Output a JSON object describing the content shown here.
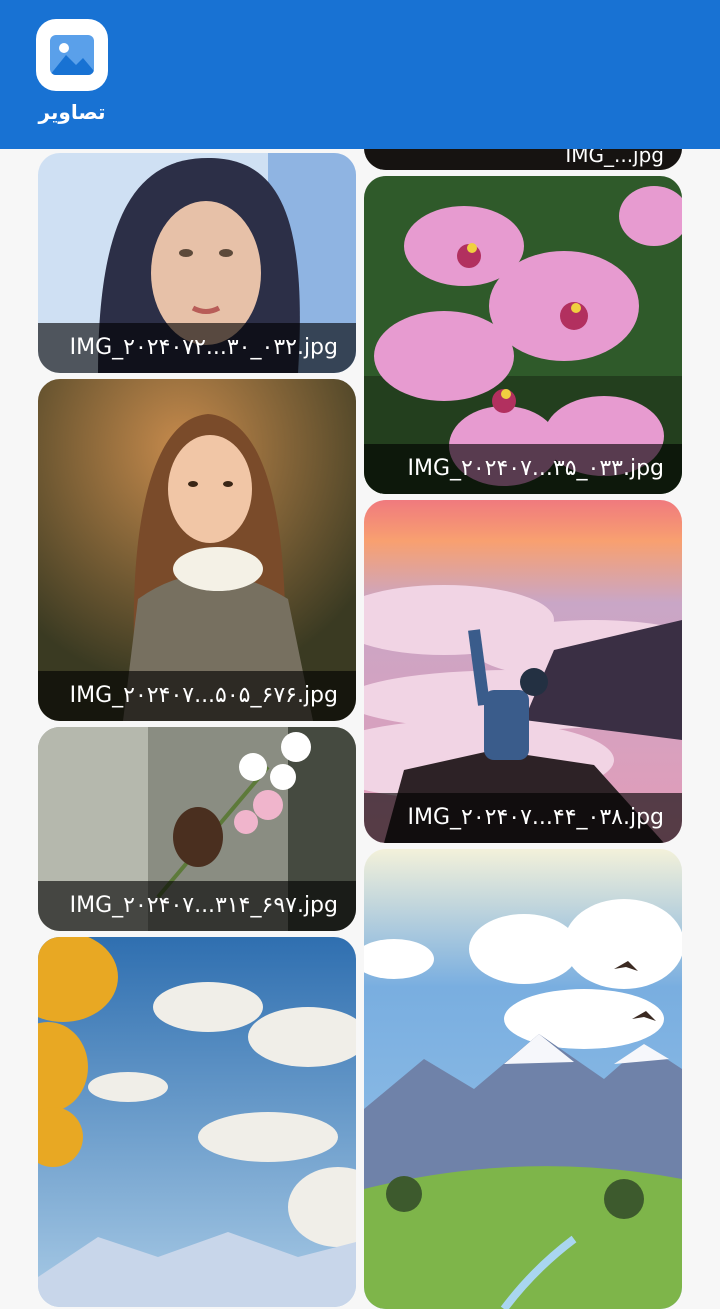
{
  "app": {
    "title": "تصاویر",
    "icon": "image-icon",
    "accent": "#1872d3"
  },
  "gallery": {
    "items": [
      {
        "name": "IMG_۲۰۲۴۰۷...۳۵_۰۳۳.jpg",
        "subject": "pink-orchids"
      },
      {
        "name": "IMG_۲۰۲۴۰۷۲...۳۰_۰۳۲.jpg",
        "subject": "woman-portrait"
      },
      {
        "name": "IMG_۲۰۲۴۰۷...۴۴_۰۳۸.jpg",
        "subject": "man-above-clouds"
      },
      {
        "name": "IMG_۲۰۲۴۰۷...۵۰۵_۶۷۶.jpg",
        "subject": "girl-with-dove"
      },
      {
        "name": "IMG_۲۰۲۴۰۷...۳۱۴_۶۹۷.jpg",
        "subject": "hand-with-flowers"
      },
      {
        "name": "",
        "subject": "mountain-landscape"
      },
      {
        "name": "",
        "subject": "sky-tree-landscape"
      }
    ]
  }
}
